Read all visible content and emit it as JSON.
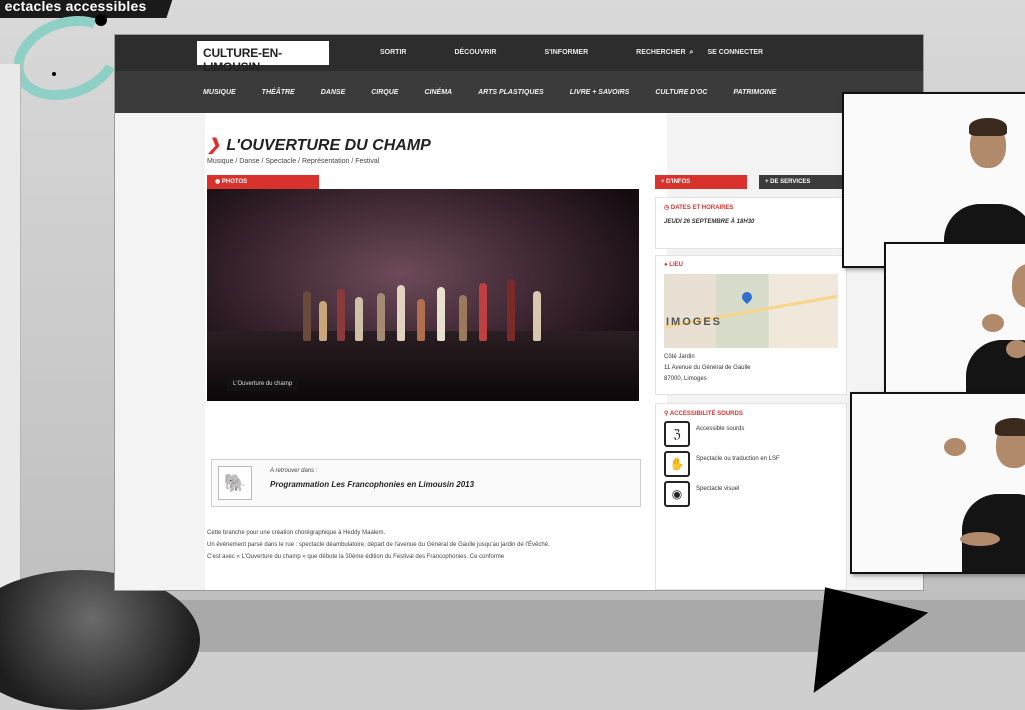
{
  "banner": {
    "text": "ectacles accessibles"
  },
  "site": {
    "logo_text": "CULTURE-EN-LIMOUSIN",
    "top_nav": [
      "SORTIR",
      "DÉCOUVRIR",
      "S'INFORMER",
      "RECHERCHER",
      "SE CONNECTER"
    ],
    "categories": [
      "MUSIQUE",
      "THÉÂTRE",
      "DANSE",
      "CIRQUE",
      "CINÉMA",
      "ARTS PLASTIQUES",
      "LIVRE + SAVOIRS",
      "CULTURE D'OC",
      "PATRIMOINE"
    ]
  },
  "event": {
    "title": "L'OUVERTURE DU CHAMP",
    "subtitle": "Musique / Danse / Spectacle / Représentation / Festival",
    "photos_tab": "PHOTOS",
    "photo_caption": "L'Ouverture du champ",
    "related_pre": "A retrouver dans :",
    "related_title": "Programmation Les Francophonies en Limousin 2013",
    "body_lines": [
      "Cette branche pour une création chorégraphique à Heddy Maalem.",
      "Un événement parsé dans le rue : spectacle déambulatoire, départ de l'avenue du Général de Gaulle jusqu'au jardin de l'Évêché.",
      "C'est avec « L'Ouverture du champ » que débute la 30ème édition du Festival des Francophonies. Ce conforme"
    ]
  },
  "sidebar": {
    "btn_info": "+ D'INFOS",
    "btn_services": "+ DE SERVICES",
    "dates_header": "DATES ET HORAIRES",
    "dates_value": "JEUDI 26 SEPTEMBRE À 18H30",
    "lieu_header": "LIEU",
    "map_label": "IMOGES",
    "address_lines": [
      "Côté Jardin",
      "11 Avenue du Général de Gaulle",
      "87000, Limoges"
    ],
    "access_header": "ACCESSIBILITÉ SOURDS",
    "access_items": [
      "Accessible sourds",
      "Spectacle ou traduction en LSF",
      "Spectacle visuel"
    ]
  }
}
